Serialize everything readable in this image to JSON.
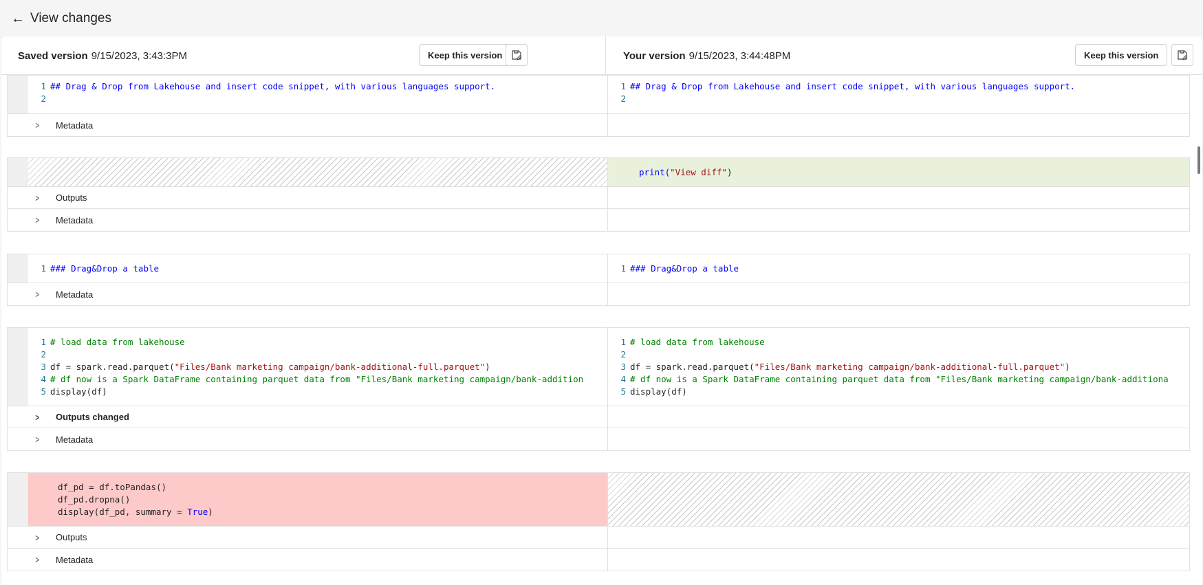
{
  "header": {
    "title": "View changes"
  },
  "saved_version": {
    "label": "Saved version",
    "date": "9/15/2023, 3:43:3PM",
    "keep_label": "Keep this version"
  },
  "your_version": {
    "label": "Your version",
    "date": "9/15/2023, 3:44:48PM",
    "keep_label": "Keep this version"
  },
  "cells": {
    "c1": {
      "left_lines": [
        {
          "n": "1",
          "text": "## Drag & Drop from Lakehouse and insert code snippet, with various languages support."
        },
        {
          "n": "2",
          "text": ""
        }
      ],
      "right_lines": [
        {
          "n": "1",
          "text": "## Drag & Drop from Lakehouse and insert code snippet, with various languages support."
        },
        {
          "n": "2",
          "text": ""
        }
      ],
      "metadata_label": "Metadata"
    },
    "c2": {
      "right_code": {
        "fn": "print(",
        "str": "\"View diff\"",
        "end": ")"
      },
      "outputs_label": "Outputs",
      "metadata_label": "Metadata"
    },
    "c3": {
      "left_lines": [
        {
          "n": "1",
          "text": "### Drag&Drop a table"
        }
      ],
      "right_lines": [
        {
          "n": "1",
          "text": "### Drag&Drop a table"
        }
      ],
      "metadata_label": "Metadata"
    },
    "c4": {
      "l1": {
        "n": "1",
        "text": "# load data from lakehouse"
      },
      "l2": {
        "n": "2"
      },
      "l3": {
        "n": "3",
        "pre": "df = spark.read.parquet(",
        "str": "\"Files/Bank marketing campaign/bank-additional-full.parquet\"",
        "post": ")"
      },
      "l4": {
        "n": "4",
        "left_text": "# df now is a Spark DataFrame containing parquet data from \"Files/Bank marketing campaign/bank-addition",
        "right_text": "# df now is a Spark DataFrame containing parquet data from \"Files/Bank marketing campaign/bank-additiona"
      },
      "l5": {
        "n": "5",
        "text": "display(df)"
      },
      "outputs_label": "Outputs changed",
      "metadata_label": "Metadata"
    },
    "c5": {
      "line1": "df_pd = df.toPandas()",
      "line2": "df_pd.dropna()",
      "line3_pre": "display(df_pd, summary = ",
      "line3_kw": "True",
      "line3_post": ")",
      "outputs_label": "Outputs",
      "metadata_label": "Metadata"
    }
  },
  "colors": {
    "added_bg": "#e9f0dc",
    "removed_bg": "#fdc9c9",
    "keyword": "#0000ff",
    "comment": "#008000",
    "string": "#a31515"
  }
}
